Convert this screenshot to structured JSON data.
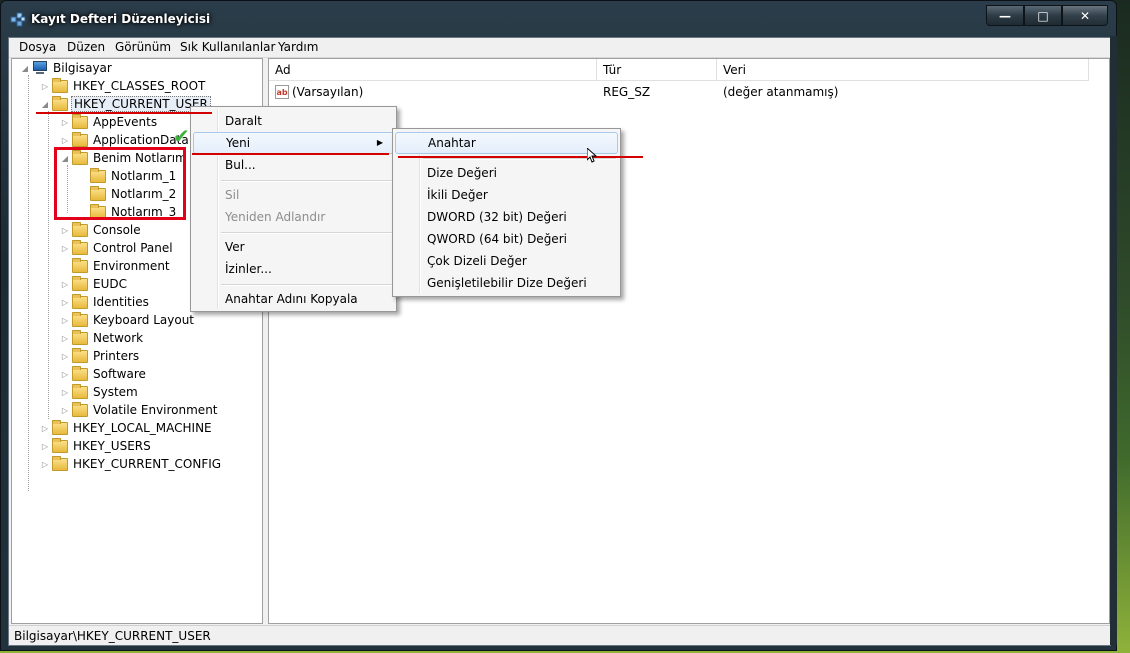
{
  "window": {
    "title": "Kayıt Defteri Düzenleyicisi",
    "buttons": {
      "minimize": "—",
      "maximize": "□",
      "close": "✕"
    }
  },
  "menubar": [
    "Dosya",
    "Düzen",
    "Görünüm",
    "Sık Kullanılanlar",
    "Yardım"
  ],
  "tree": {
    "root": "Bilgisayar",
    "hkcr": "HKEY_CLASSES_ROOT",
    "hkcu": "HKEY_CURRENT_USER",
    "hkcu_children": [
      "AppEvents",
      "ApplicationData",
      "Benim Notlarım"
    ],
    "notlar_children": [
      "Notlarım_1",
      "Notlarım_2",
      "Notlarım_3"
    ],
    "hkcu_children_rest": [
      "Console",
      "Control Panel",
      "Environment",
      "EUDC",
      "Identities",
      "Keyboard Layout",
      "Network",
      "Printers",
      "Software",
      "System",
      "Volatile Environment"
    ],
    "hklm": "HKEY_LOCAL_MACHINE",
    "hku": "HKEY_USERS",
    "hkcc": "HKEY_CURRENT_CONFIG"
  },
  "list": {
    "columns": [
      "Ad",
      "Tür",
      "Veri"
    ],
    "rows": [
      {
        "name": "(Varsayılan)",
        "type": "REG_SZ",
        "data": "(değer atanmamış)"
      }
    ]
  },
  "context_menu": {
    "items": [
      "Daralt",
      "Yeni",
      "Bul...",
      "Sil",
      "Yeniden Adlandır",
      "Ver",
      "İzinler...",
      "Anahtar Adını Kopyala"
    ]
  },
  "submenu": {
    "items": [
      "Anahtar",
      "Dize Değeri",
      "İkili Değer",
      "DWORD (32 bit) Değeri",
      "QWORD (64 bit) Değeri",
      "Çok Dizeli Değer",
      "Genişletilebilir Dize Değeri"
    ]
  },
  "status": "Bilgisayar\\HKEY_CURRENT_USER",
  "colors": {
    "annotation_red": "#d40000",
    "check_green": "#3db03d"
  },
  "icons": {
    "app": "registry-icon",
    "computer": "computer-icon",
    "folder": "folder-icon",
    "string_value": "string-value-icon"
  }
}
